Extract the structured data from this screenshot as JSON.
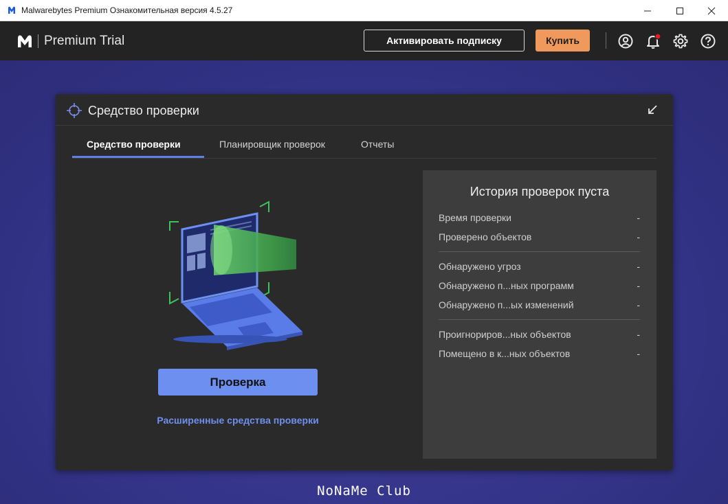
{
  "window": {
    "title": "Malwarebytes Premium Ознакомительная версия  4.5.27",
    "controls": [
      "minimize",
      "maximize",
      "close"
    ]
  },
  "header": {
    "product_name": "Premium Trial",
    "activate_label": "Активировать подписку",
    "buy_label": "Купить",
    "icons": [
      "account-icon",
      "notifications-icon",
      "settings-icon",
      "help-icon"
    ],
    "notification_dot_color": "#e02020"
  },
  "panel": {
    "title": "Средство проверки",
    "tabs": [
      {
        "label": "Средство проверки",
        "active": true
      },
      {
        "label": "Планировщик проверок",
        "active": false
      },
      {
        "label": "Отчеты",
        "active": false
      }
    ],
    "scan_button_label": "Проверка",
    "advanced_link_label": "Расширенные средства проверки"
  },
  "history": {
    "title": "История проверок пуста",
    "groups": [
      [
        {
          "label": "Время проверки",
          "value": "-"
        },
        {
          "label": "Проверено объектов",
          "value": "-"
        }
      ],
      [
        {
          "label": "Обнаружено угроз",
          "value": "-"
        },
        {
          "label": "Обнаружено п...ных программ",
          "value": "-"
        },
        {
          "label": "Обнаружено п...ых изменений",
          "value": "-"
        }
      ],
      [
        {
          "label": "Проигнориров...ных объектов",
          "value": "-"
        },
        {
          "label": "Помещено в к...ных объектов",
          "value": "-"
        }
      ]
    ]
  },
  "watermark": "NoNaMe Club",
  "colors": {
    "accent_blue": "#6d8ff0",
    "buy_orange": "#f0995c",
    "background": "#34348a",
    "panel": "#2a2a2a"
  }
}
